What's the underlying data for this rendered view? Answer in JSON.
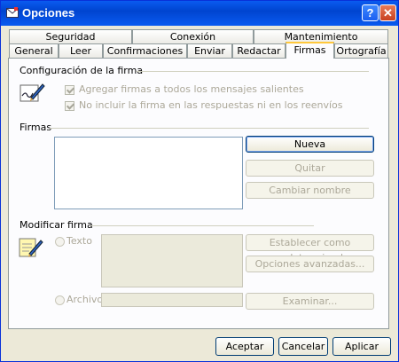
{
  "window": {
    "title": "Opciones"
  },
  "tabs_row1": [
    "Seguridad",
    "Conexión",
    "Mantenimiento"
  ],
  "tabs_row2": [
    "General",
    "Leer",
    "Confirmaciones",
    "Enviar",
    "Redactar",
    "Firmas",
    "Ortografía"
  ],
  "active_tab": "Firmas",
  "config": {
    "label": "Configuración de la firma",
    "opt1": "Agregar firmas a todos los mensajes salientes",
    "opt2": "No incluir la firma en las respuestas ni en los reenvíos"
  },
  "firmas": {
    "label": "Firmas",
    "new_btn": "Nueva",
    "remove_btn": "Quitar",
    "rename_btn": "Cambiar nombre"
  },
  "edit": {
    "label": "Modificar firma",
    "text_radio": "Texto",
    "file_radio": "Archivo",
    "set_default_btn": "Establecer como predeterminada",
    "advanced_btn": "Opciones avanzadas...",
    "browse_btn": "Examinar..."
  },
  "footer": {
    "ok": "Aceptar",
    "cancel": "Cancelar",
    "apply": "Aplicar"
  }
}
